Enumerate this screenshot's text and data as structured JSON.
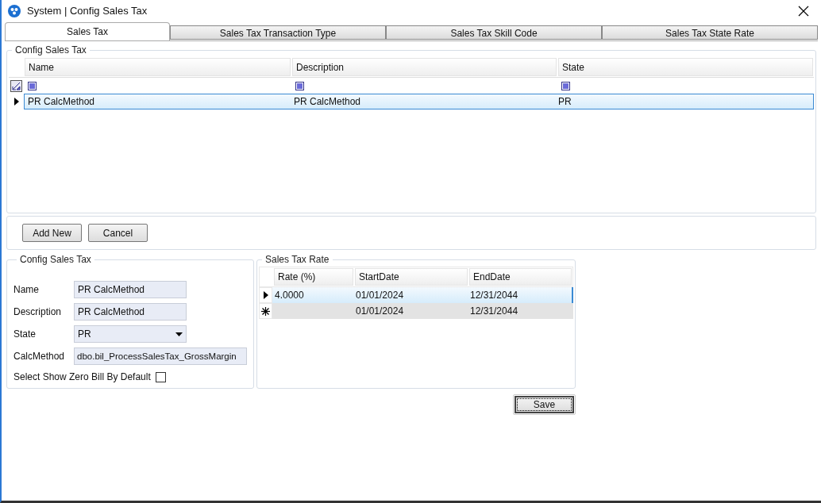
{
  "window": {
    "title": "System | Config Sales Tax"
  },
  "tabs": [
    {
      "label": "Sales Tax",
      "selected": true
    },
    {
      "label": "Sales Tax Transaction Type",
      "selected": false
    },
    {
      "label": "Sales Tax Skill Code",
      "selected": false
    },
    {
      "label": "Sales Tax State Rate",
      "selected": false
    }
  ],
  "config_grid": {
    "title": "Config Sales Tax",
    "columns": [
      "Name",
      "Description",
      "State"
    ],
    "rows": [
      {
        "selected": true,
        "cells": [
          "PR CalcMethod",
          "PR CalcMethod",
          "PR"
        ]
      }
    ]
  },
  "buttons": [
    "Add New",
    "Cancel"
  ],
  "form": {
    "title": "Config Sales Tax",
    "fields": [
      {
        "kind": "text",
        "label": "Name",
        "value": "PR CalcMethod"
      },
      {
        "kind": "text",
        "label": "Description",
        "value": "PR CalcMethod"
      },
      {
        "kind": "select",
        "label": "State",
        "value": "PR"
      },
      {
        "kind": "wide",
        "label": "CalcMethod",
        "value": "dbo.bil_ProcessSalesTax_GrossMargin"
      },
      {
        "kind": "checkbox",
        "label": "Select Show Zero Bill By Default",
        "checked": false
      }
    ]
  },
  "rate_grid": {
    "title": "Sales Tax Rate",
    "columns": [
      "Rate (%)",
      "StartDate",
      "EndDate"
    ],
    "rows": [
      {
        "kind": "current",
        "selected": true,
        "rate": "4.0000",
        "start_date": "01/01/2024",
        "end_date": "12/31/2044"
      },
      {
        "kind": "new",
        "selected": false,
        "start_date": "01/01/2024",
        "end_date": "12/31/2044"
      }
    ]
  },
  "save_button": "Save"
}
